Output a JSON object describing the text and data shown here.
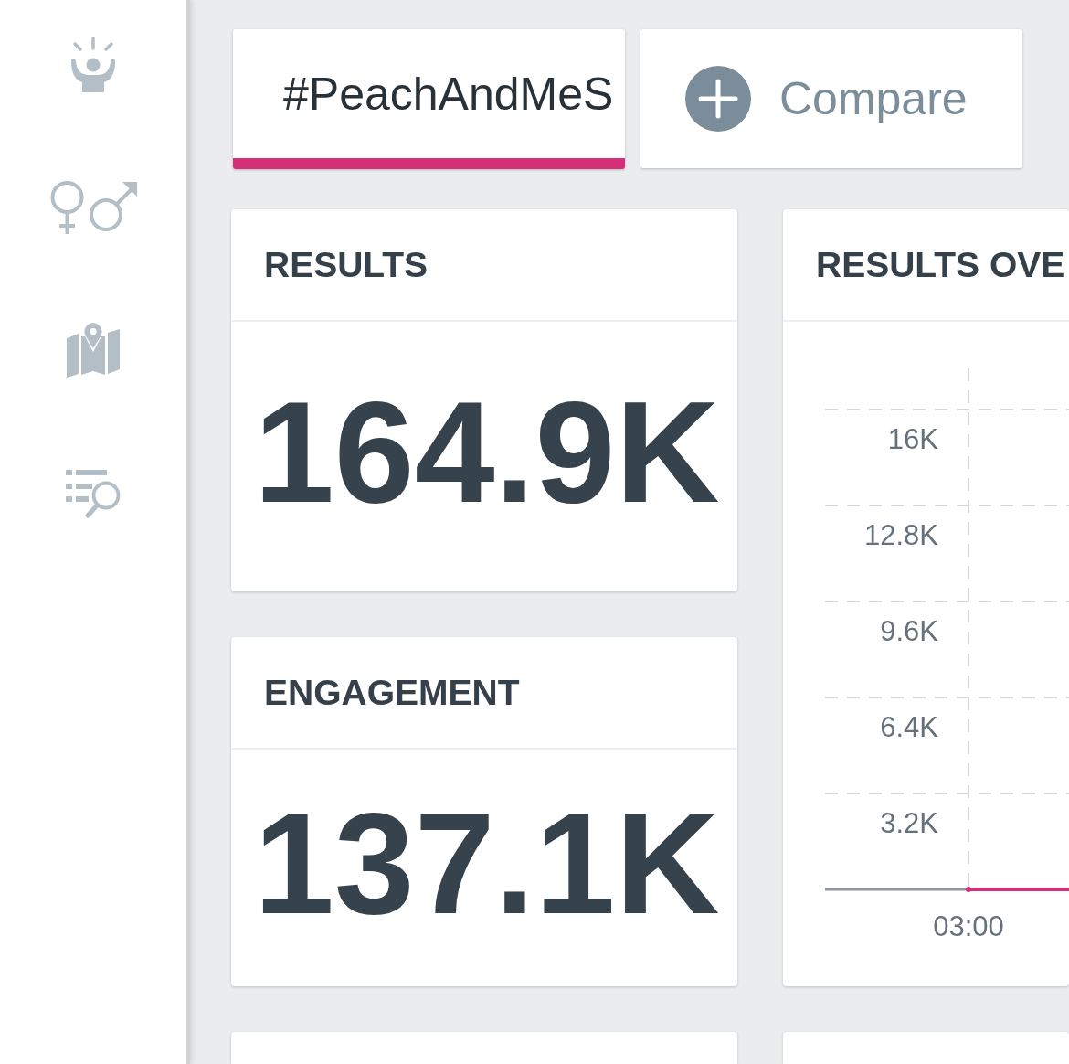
{
  "tabs": [
    {
      "label": "#PeachAndMeS",
      "selected": true
    }
  ],
  "compare_button": {
    "label": "Compare"
  },
  "cards": [
    {
      "title": "RESULTS",
      "value": "164.9K"
    },
    {
      "title": "ENGAGEMENT",
      "value": "137.1K"
    }
  ],
  "chart_card": {
    "title": "RESULTS OVE",
    "chart_data": {
      "type": "line",
      "grid": true,
      "x": [
        "03:00"
      ],
      "ylim": [
        0,
        16000
      ],
      "yticks": [
        {
          "value": 3200,
          "label": "3.2K"
        },
        {
          "value": 6400,
          "label": "6.4K"
        },
        {
          "value": 9600,
          "label": "9.6K"
        },
        {
          "value": 12800,
          "label": "12.8K"
        },
        {
          "value": 16000,
          "label": "16K"
        }
      ],
      "series": [
        {
          "color": "#d62f7a",
          "marker": true,
          "values": [
            0
          ]
        }
      ]
    }
  }
}
